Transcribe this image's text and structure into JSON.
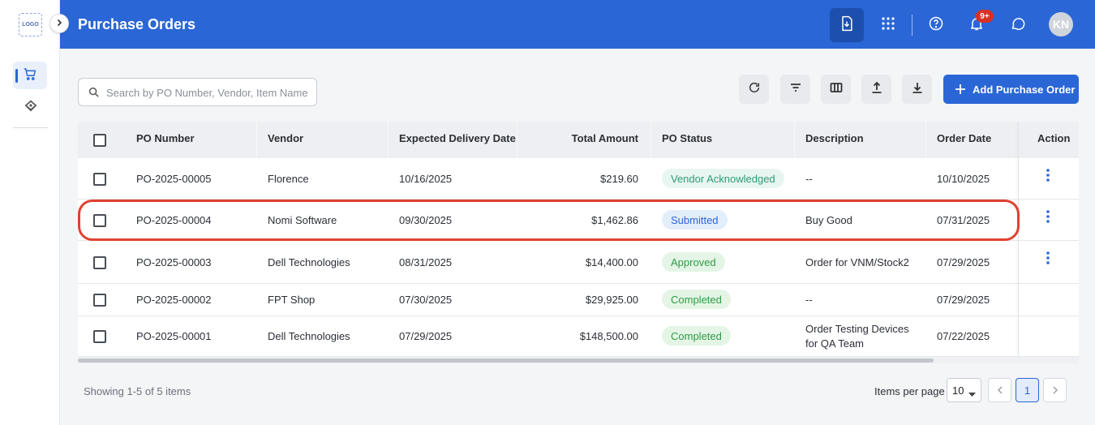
{
  "sidebar": {
    "logo_text": "LOGO",
    "items": [
      {
        "name": "purchase-orders",
        "icon": "cart-icon",
        "active": true
      },
      {
        "name": "tags",
        "icon": "tag-icon",
        "active": false
      }
    ]
  },
  "header": {
    "title": "Purchase Orders",
    "notification_badge": "9+",
    "avatar_initials": "KN",
    "color": "#2a66d6"
  },
  "toolbar": {
    "search_placeholder": "Search by PO Number, Vendor, Item Name",
    "add_label": "Add Purchase Order",
    "tools": [
      "refresh-icon",
      "filter-icon",
      "columns-icon",
      "upload-icon",
      "download-icon"
    ]
  },
  "table": {
    "columns": [
      "PO Number",
      "Vendor",
      "Expected Delivery Date",
      "Total Amount",
      "PO Status",
      "Description",
      "Order Date",
      "Action"
    ],
    "rows": [
      {
        "po": "PO-2025-00005",
        "vendor": "Florence",
        "expected": "10/16/2025",
        "amount": "$219.60",
        "status": "Vendor Acknowledged",
        "description": "--",
        "order_date": "10/10/2025",
        "has_action": true
      },
      {
        "po": "PO-2025-00004",
        "vendor": "Nomi Software",
        "expected": "09/30/2025",
        "amount": "$1,462.86",
        "status": "Submitted",
        "description": "Buy Good",
        "order_date": "07/31/2025",
        "has_action": true
      },
      {
        "po": "PO-2025-00003",
        "vendor": "Dell Technologies",
        "expected": "08/31/2025",
        "amount": "$14,400.00",
        "status": "Approved",
        "description": "Order for VNM/Stock2",
        "order_date": "07/29/2025",
        "has_action": true
      },
      {
        "po": "PO-2025-00002",
        "vendor": "FPT Shop",
        "expected": "07/30/2025",
        "amount": "$29,925.00",
        "status": "Completed",
        "description": "--",
        "order_date": "07/29/2025",
        "has_action": false
      },
      {
        "po": "PO-2025-00001",
        "vendor": "Dell Technologies",
        "expected": "07/29/2025",
        "amount": "$148,500.00",
        "status": "Completed",
        "description": "Order Testing Devices for QA Team",
        "order_date": "07/22/2025",
        "has_action": false
      }
    ],
    "status_colors": {
      "Vendor Acknowledged": {
        "bg": "#e8f6f1",
        "fg": "#2f9a76"
      },
      "Submitted": {
        "bg": "#e3eefb",
        "fg": "#2a66d6"
      },
      "Approved": {
        "bg": "#e4f5e6",
        "fg": "#2e9b45"
      },
      "Completed": {
        "bg": "#e4f5e6",
        "fg": "#2e9b45"
      }
    },
    "highlighted_row": "PO-2025-00004"
  },
  "footer": {
    "showing_text": "Showing 1-5 of 5 items",
    "items_per_page_label": "Items per page",
    "items_per_page_value": "10",
    "current_page": "1"
  }
}
